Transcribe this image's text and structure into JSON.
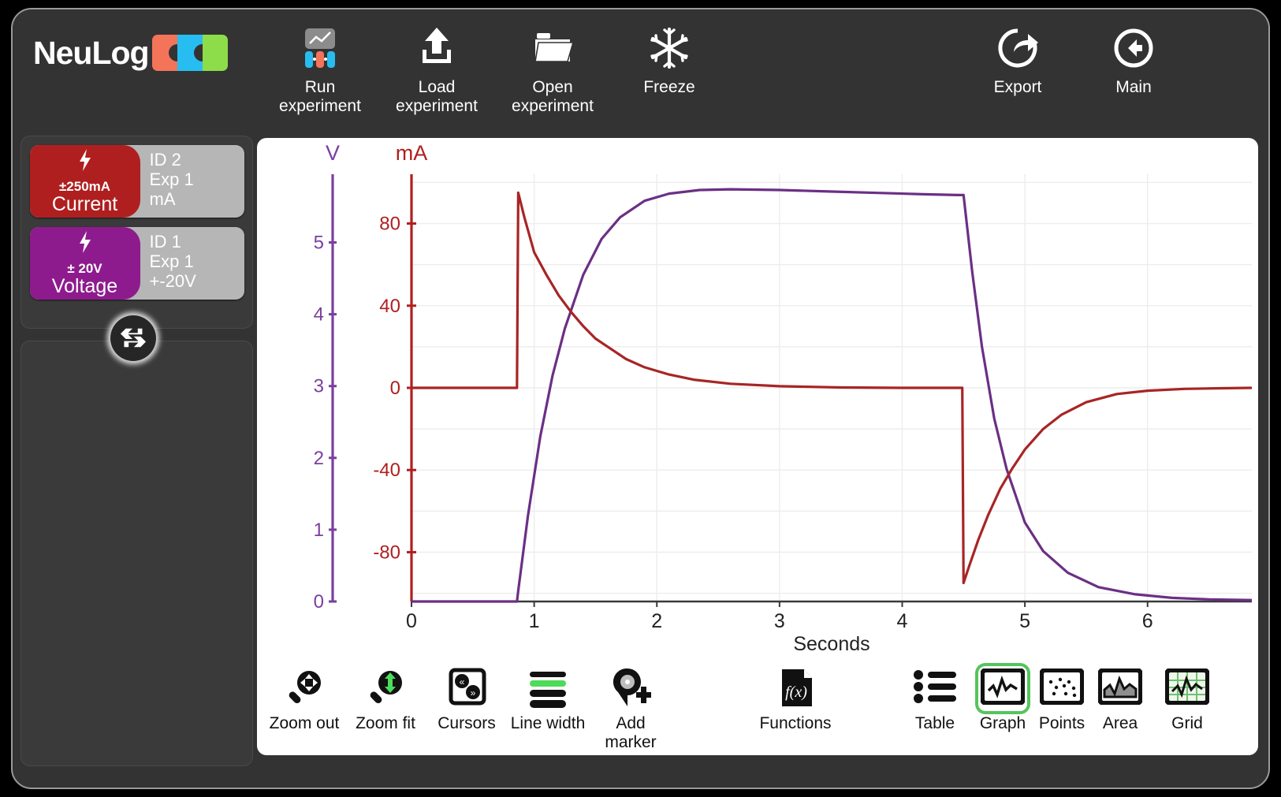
{
  "app": {
    "brand": "NeuLog"
  },
  "logo": {
    "colors": [
      "#f4745a",
      "#28bdf0",
      "#8ddc4a"
    ]
  },
  "toolbar": {
    "items": [
      {
        "label": "Run\nexperiment",
        "icon": "run-experiment-icon"
      },
      {
        "label": "Load\nexperiment",
        "icon": "load-experiment-icon"
      },
      {
        "label": "Open\nexperiment",
        "icon": "open-experiment-icon"
      },
      {
        "label": "Freeze",
        "icon": "snowflake-icon"
      },
      {
        "label": "Export",
        "icon": "export-icon"
      },
      {
        "label": "Main",
        "icon": "back-arrow-icon"
      }
    ]
  },
  "sensors": [
    {
      "name": "Current",
      "range": "±250mA",
      "id": "ID 2",
      "exp": "Exp 1",
      "unit": "mA",
      "color": "#b01f1f",
      "icon": "lightning-bolt-icon"
    },
    {
      "name": "Voltage",
      "range": "± 20V",
      "id": "ID 1",
      "exp": "Exp 1",
      "unit": "+-20V",
      "color": "#8e1b8e",
      "icon": "lightning-bolt-icon"
    }
  ],
  "swap_button": {
    "icon": "swap-arrows-icon"
  },
  "bottom_toolbar": {
    "left_items": [
      {
        "label": "Zoom out",
        "icon": "zoom-out-icon"
      },
      {
        "label": "Zoom fit",
        "icon": "zoom-fit-icon"
      },
      {
        "label": "Cursors",
        "icon": "cursors-icon"
      },
      {
        "label": "Line width",
        "icon": "line-width-icon"
      },
      {
        "label": "Add\nmarker",
        "icon": "add-marker-icon"
      },
      {
        "label": "Functions",
        "icon": "functions-icon"
      }
    ],
    "view_items": [
      {
        "label": "Table",
        "icon": "table-icon",
        "active": false
      },
      {
        "label": "Graph",
        "icon": "graph-icon",
        "active": true
      },
      {
        "label": "Points",
        "icon": "points-icon",
        "active": false
      },
      {
        "label": "Area",
        "icon": "area-icon",
        "active": false
      },
      {
        "label": "Grid",
        "icon": "grid-icon",
        "active": false
      }
    ],
    "active_color": "#55c45c"
  },
  "chart_data": {
    "type": "line",
    "title": "",
    "xlabel": "Seconds",
    "xlim": [
      0,
      6.85
    ],
    "xticks": [
      0,
      1,
      2,
      3,
      4,
      5,
      6
    ],
    "grid": true,
    "axes": [
      {
        "name": "voltage-axis",
        "label": "V",
        "unit": "V",
        "color": "#7a3fa0",
        "ylim": [
          0,
          5.95
        ],
        "yticks": [
          0,
          1,
          2,
          3,
          4,
          5
        ],
        "position": "left-outer"
      },
      {
        "name": "current-axis",
        "label": "mA",
        "unit": "mA",
        "color": "#b01f1f",
        "ylim": [
          -104,
          104
        ],
        "yticks": [
          -80,
          -40,
          0,
          40,
          80
        ],
        "position": "left-inner"
      }
    ],
    "series": [
      {
        "name": "Current",
        "axis": "current-axis",
        "color": "#a82525",
        "unit": "mA",
        "description": "Capacitor charge/discharge current: flat 0 until 0.87 s, spikes to +95 mA, exponential decay to 0 by ~2.5 s, holds 0 until 4.50 s, drops to -95 mA, exponential rise back to 0 by ~6.2 s",
        "x": [
          0.0,
          0.2,
          0.4,
          0.6,
          0.8,
          0.86,
          0.87,
          0.92,
          1.0,
          1.1,
          1.2,
          1.3,
          1.4,
          1.5,
          1.6,
          1.75,
          1.9,
          2.1,
          2.3,
          2.6,
          3.0,
          3.5,
          4.0,
          4.45,
          4.49,
          4.5,
          4.55,
          4.62,
          4.7,
          4.8,
          4.9,
          5.0,
          5.15,
          5.3,
          5.5,
          5.75,
          6.0,
          6.3,
          6.6,
          6.85
        ],
        "y": [
          0,
          0,
          0,
          0,
          0,
          0,
          95,
          83,
          66,
          55,
          45,
          37,
          30,
          24,
          20,
          14,
          10,
          6.5,
          4,
          2,
          0.8,
          0.2,
          0,
          0,
          0,
          -95,
          -86,
          -74,
          -62,
          -49,
          -39,
          -30,
          -20,
          -13,
          -7,
          -3,
          -1.4,
          -0.5,
          -0.2,
          0
        ]
      },
      {
        "name": "Voltage",
        "axis": "voltage-axis",
        "color": "#6b2f85",
        "unit": "V",
        "description": "Capacitor voltage: 0 V until 0.87 s, exponential rise to ~5.73 V plateau, slight droop, then sharp fall at 4.50 s with exponential decay toward 0 V",
        "x": [
          0.0,
          0.3,
          0.6,
          0.8,
          0.86,
          0.87,
          0.95,
          1.05,
          1.15,
          1.25,
          1.4,
          1.55,
          1.7,
          1.9,
          2.1,
          2.35,
          2.6,
          3.0,
          3.4,
          3.8,
          4.2,
          4.45,
          4.5,
          4.57,
          4.65,
          4.75,
          4.85,
          5.0,
          5.15,
          5.35,
          5.6,
          5.9,
          6.2,
          6.5,
          6.85
        ],
        "y": [
          0,
          0,
          0,
          0,
          0,
          0.15,
          1.2,
          2.3,
          3.15,
          3.8,
          4.55,
          5.05,
          5.35,
          5.58,
          5.68,
          5.73,
          5.74,
          5.73,
          5.71,
          5.69,
          5.67,
          5.66,
          5.66,
          4.6,
          3.55,
          2.55,
          1.85,
          1.1,
          0.7,
          0.4,
          0.2,
          0.1,
          0.05,
          0.03,
          0.02
        ]
      }
    ]
  }
}
